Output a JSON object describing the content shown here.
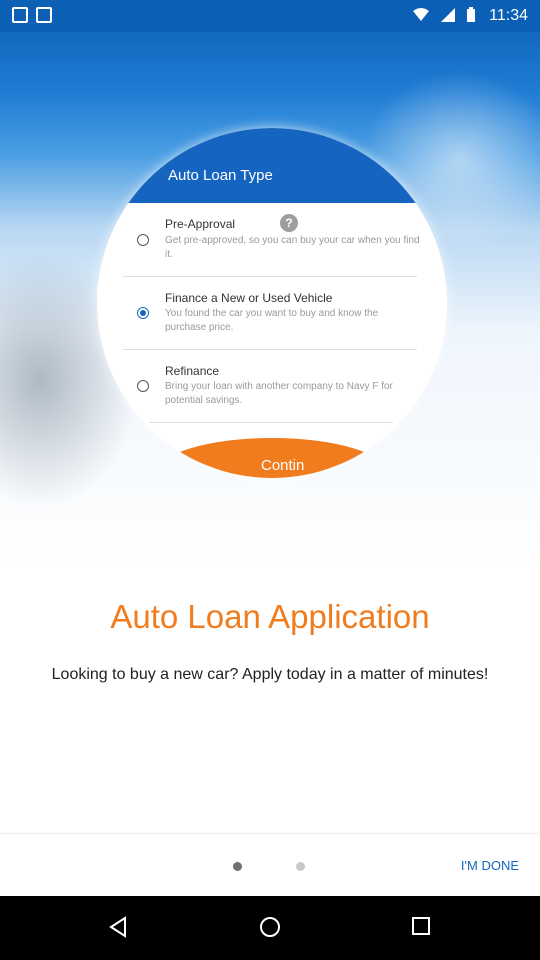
{
  "status_bar": {
    "time": "11:34"
  },
  "loan_card": {
    "header": "Auto Loan Type",
    "options": [
      {
        "title": "Pre-Approval",
        "desc": "Get pre-approved, so you can buy your car when you find it.",
        "selected": false,
        "help": "?"
      },
      {
        "title": "Finance a New or Used Vehicle",
        "desc": "You found the car you want to buy and know the purchase price.",
        "selected": true
      },
      {
        "title": "Refinance",
        "desc": "Bring your loan with another company to Navy F for potential savings.",
        "selected": false
      }
    ],
    "continue_label": "Contin"
  },
  "main": {
    "title": "Auto Loan Application",
    "subtitle": "Looking to buy a new car? Apply today in a matter of minutes!"
  },
  "pager": {
    "done_label": "I'M DONE",
    "pages": 2,
    "current": 0
  },
  "colors": {
    "accent": "#f07c1e",
    "primary": "#1565c0"
  }
}
